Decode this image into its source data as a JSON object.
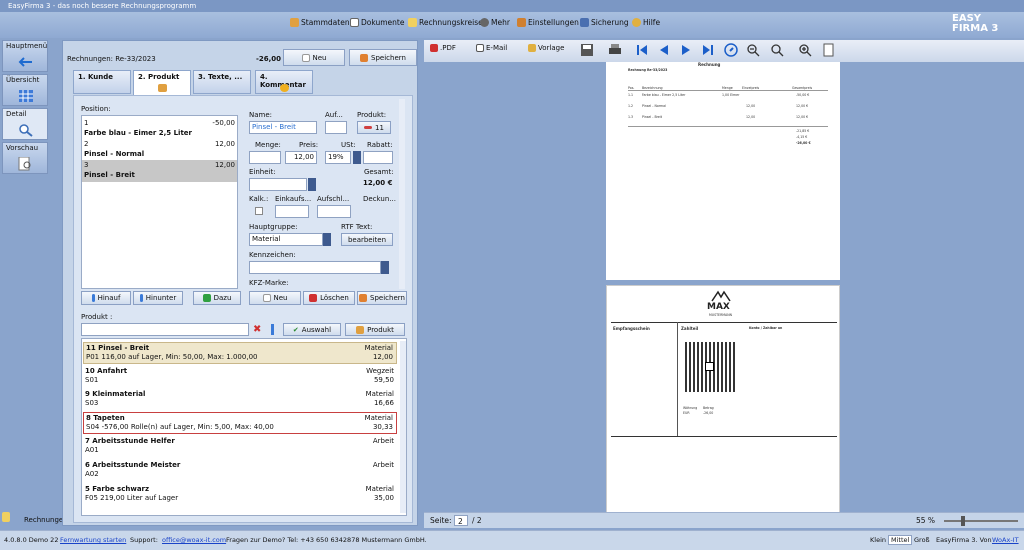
{
  "window": {
    "title": "EasyFirma 3 - das noch bessere Rechnungsprogramm"
  },
  "menu": {
    "items": [
      {
        "label": "Stammdaten",
        "icon": "stammdaten-icon"
      },
      {
        "label": "Dokumente",
        "icon": "documents-icon"
      },
      {
        "label": "Rechnungskreise",
        "icon": "invoice-circles-icon"
      },
      {
        "label": "Mehr",
        "icon": "more-icon"
      },
      {
        "label": "Einstellungen",
        "icon": "settings-icon"
      },
      {
        "label": "Sicherung",
        "icon": "backup-icon"
      },
      {
        "label": "Hilfe",
        "icon": "help-icon"
      }
    ],
    "logo_top": "EASY",
    "logo_bottom": "FIRMA 3"
  },
  "nav": {
    "items": [
      {
        "label": "Hauptmenü"
      },
      {
        "label": "Übersicht"
      },
      {
        "label": "Detail"
      },
      {
        "label": "Vorschau"
      }
    ],
    "bottom_label": "Rechnunge"
  },
  "editor": {
    "doc_title": "Rechnungen: Re-33/2023",
    "total": "-26,00",
    "new_label": "Neu",
    "save_label": "Speichern",
    "tabs": [
      "1. Kunde",
      "2. Produkt",
      "3. Texte, ...",
      "4. Kommentar"
    ],
    "position_label": "Position:",
    "positions": [
      {
        "line1": "1",
        "amount": "-50,00",
        "line2": "Farbe blau - Eimer 2,5 Liter"
      },
      {
        "line1": "2",
        "amount": "12,00",
        "line2": "Pinsel - Normal"
      },
      {
        "line1": "3",
        "amount": "12,00",
        "line2": "Pinsel - Breit"
      }
    ],
    "labels": {
      "name": "Name:",
      "auf": "Auf...",
      "produkt": "Produkt:",
      "menge": "Menge:",
      "preis": "Preis:",
      "ust": "USt:",
      "rabatt": "Rabatt:",
      "einheit": "Einheit:",
      "gesamt": "Gesamt:",
      "kalk": "Kalk.:",
      "einkauf": "Einkaufs...",
      "aufschl": "Aufschl...",
      "deckun": "Deckun...",
      "hauptgruppe": "Hauptgruppe:",
      "rtf": "RTF Text:",
      "kennzeichen": "Kennzeichen:",
      "kfz": "KFZ-Marke:",
      "produkt_search": "Produkt :"
    },
    "values": {
      "name": "Pinsel - Breit",
      "produkt_nr": "11",
      "preis": "12,00",
      "ust": "19%",
      "gesamt": "12,00 €",
      "hauptgruppe": "Material"
    },
    "buttons": {
      "hinauf": "Hinauf",
      "hinunter": "Hinunter",
      "dazu": "Dazu",
      "neu": "Neu",
      "loeschen": "Löschen",
      "speichern": "Speichern",
      "bearbeiten": "bearbeiten",
      "auswahl": "Auswahl",
      "produkt": "Produkt"
    },
    "products": [
      {
        "title": "11 Pinsel - Breit",
        "cat": "Material",
        "sub": "P01 116,00 auf Lager, Min: 50,00, Max: 1.000,00",
        "val": "12,00"
      },
      {
        "title": "10 Anfahrt",
        "cat": "Wegzeit",
        "sub": "S01",
        "val": "59,50"
      },
      {
        "title": "9 Kleinmaterial",
        "cat": "Material",
        "sub": "S03",
        "val": "16,66"
      },
      {
        "title": "8 Tapeten",
        "cat": "Material",
        "sub": "S04 -576,00 Rolle(n) auf Lager, Min: 5,00, Max: 40,00",
        "val": "30,33"
      },
      {
        "title": "7 Arbeitsstunde Helfer",
        "cat": "Arbeit",
        "sub": "A01",
        "val": ""
      },
      {
        "title": "6 Arbeitsstunde Meister",
        "cat": "Arbeit",
        "sub": "A02",
        "val": ""
      },
      {
        "title": "5 Farbe schwarz",
        "cat": "Material",
        "sub": "F05 219,00 Liter auf Lager",
        "val": "35,00"
      }
    ]
  },
  "preview": {
    "toolbar": {
      "pdf": ".PDF",
      "email": "E-Mail",
      "vorlage": "Vorlage"
    },
    "page1": {
      "heading": "Rechnung",
      "number": "Rechnung Re-33/2023",
      "rows": [
        {
          "pos": "Pos.",
          "text": "Bezeichnung",
          "qty": "Menge",
          "price": "Einzelpreis",
          "total": "Gesamtpreis"
        },
        {
          "pos": "1.1",
          "text": "Farbe blau - Eimer 2,5 Liter",
          "qty": "1,00 Eimer",
          "price": "",
          "total": "-50,00 €"
        },
        {
          "pos": "1.2",
          "text": "Pinsel - Normal",
          "qty": "",
          "price": "12,00",
          "total": "12,00 €"
        },
        {
          "pos": "1.3",
          "text": "Pinsel - Breit",
          "qty": "",
          "price": "12,00",
          "total": "12,00 €"
        }
      ],
      "sum_net": "-21,85 €",
      "sum_tax": "-4,15 €",
      "sum_gross": "-26,00 €"
    },
    "page2": {
      "brand": "MAX",
      "brand_sub": "MUSTERMANN",
      "receiver": "Empfangsschein",
      "zahlteil": "Zahlteil",
      "konto": "Konto / Zahlbar an",
      "waehrung": "Währung",
      "betrag": "Betrag",
      "chf": "EUR",
      "amount": "-26,00"
    },
    "status": {
      "seite_label": "Seite:",
      "page": "2",
      "of": "/ 2",
      "zoom": "55 %"
    }
  },
  "status": {
    "version": "4.0.8.0 Demo 22",
    "wartung": "Fernwartung starten",
    "support_label": "Support:",
    "support_email": "office@woax-it.com",
    "demo_text": "Fragen zur Demo? Tel: +43 650 6342878 Mustermann GmbH.",
    "size_klein": "Klein",
    "size_mittel": "Mittel",
    "size_gross": "Groß",
    "product": "EasyFirma 3. Von",
    "vendor": "WoAx-IT"
  }
}
